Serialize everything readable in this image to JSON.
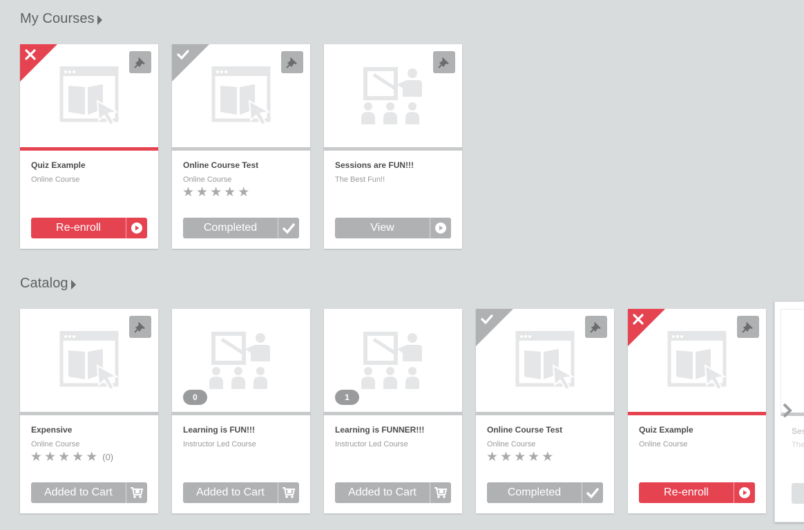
{
  "sections": {
    "my_courses": {
      "title": "My Courses"
    },
    "catalog": {
      "title": "Catalog"
    }
  },
  "colors": {
    "accent": "#e64350",
    "neutral": "#b0b1b3",
    "background": "#d9dcdd"
  },
  "my_courses": [
    {
      "title": "Quiz Example",
      "subtitle": "Online Course",
      "status": "failed",
      "icon": "online-course-icon",
      "button": "Re-enroll",
      "button_icon": "play-icon"
    },
    {
      "title": "Online Course Test",
      "subtitle": "Online Course",
      "status": "completed",
      "icon": "online-course-icon",
      "rating": 0,
      "button": "Completed",
      "button_icon": "check-icon"
    },
    {
      "title": "Sessions are FUN!!!",
      "subtitle": "The Best Fun!!",
      "icon": "instructor-led-icon",
      "button": "View",
      "button_icon": "play-icon"
    }
  ],
  "catalog": [
    {
      "title": "Expensive",
      "subtitle": "Online Course",
      "icon": "online-course-icon",
      "rating": 0,
      "rating_count": "(0)",
      "button": "Added to Cart",
      "button_icon": "cart-icon"
    },
    {
      "title": "Learning is FUN!!!",
      "subtitle": "Instructor Led Course",
      "icon": "instructor-led-icon",
      "badge": "0",
      "button": "Added to Cart",
      "button_icon": "cart-icon"
    },
    {
      "title": "Learning is FUNNER!!!",
      "subtitle": "Instructor Led Course",
      "icon": "instructor-led-icon",
      "badge": "1",
      "button": "Added to Cart",
      "button_icon": "cart-icon"
    },
    {
      "title": "Online Course Test",
      "subtitle": "Online Course",
      "status": "completed",
      "icon": "online-course-icon",
      "rating": 0,
      "button": "Completed",
      "button_icon": "check-icon"
    },
    {
      "title": "Quiz Example",
      "subtitle": "Online Course",
      "status": "failed",
      "icon": "online-course-icon",
      "button": "Re-enroll",
      "button_icon": "play-icon"
    }
  ],
  "catalog_next": {
    "title": "Ses",
    "subtitle": "The"
  },
  "icons": {
    "pin": "pin-icon",
    "next": "chevron-right-icon"
  }
}
